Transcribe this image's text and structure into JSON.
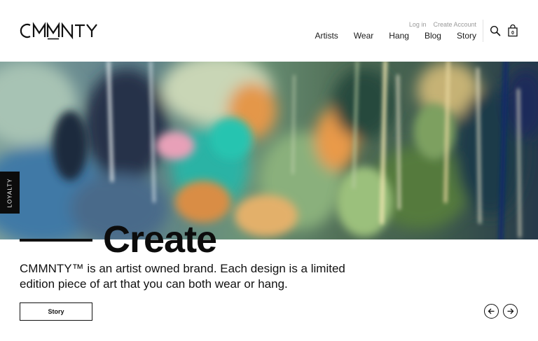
{
  "brand": {
    "logo_text": "CMMNTY"
  },
  "account": {
    "login_label": "Log in",
    "create_label": "Create Account"
  },
  "nav": {
    "items": [
      "Artists",
      "Wear",
      "Hang",
      "Blog",
      "Story"
    ]
  },
  "icons": {
    "search": "search-icon",
    "bag": "shopping-bag-icon",
    "prev": "arrow-left-icon",
    "next": "arrow-right-icon"
  },
  "cart": {
    "count": "0"
  },
  "loyalty": {
    "label": "LOYALTY"
  },
  "hero": {
    "headline": "Create",
    "description": "CMMNTY™ is an artist owned brand. Each design is a limited edition piece of art that you can both wear or hang.",
    "button_label": "Story"
  },
  "colors": {
    "text": "#111111",
    "muted": "#9a9a9a",
    "background": "#ffffff",
    "accent_teal": "#2fb5a6",
    "accent_orange": "#e99a4a"
  }
}
